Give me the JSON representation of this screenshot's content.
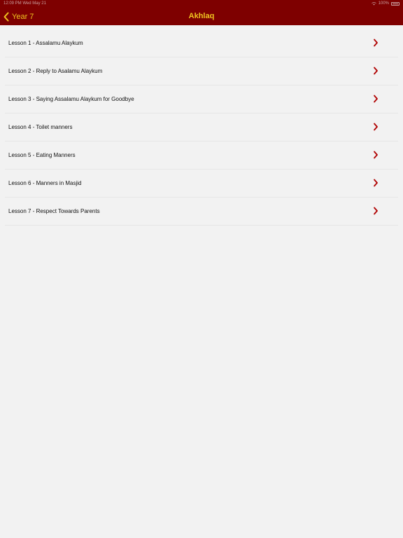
{
  "status_bar": {
    "time_date": "12:09 PM   Wed May 21",
    "battery": "100%",
    "icons": [
      "wifi-icon",
      "battery-icon"
    ]
  },
  "nav": {
    "back_label": "Year 7",
    "title": "Akhlaq",
    "back_icon": "chevron-left-icon"
  },
  "lessons": [
    {
      "label": "Lesson 1 - Assalamu Alaykum"
    },
    {
      "label": "Lesson 2 - Reply to Asalamu Alaykum"
    },
    {
      "label": "Lesson 3 - Saying Assalamu Alaykum for Goodbye"
    },
    {
      "label": "Lesson 4 - Toilet manners"
    },
    {
      "label": "Lesson 5 - Eating Manners"
    },
    {
      "label": "Lesson 6 - Manners in Masjid"
    },
    {
      "label": "Lesson 7 - Respect Towards Parents"
    }
  ],
  "colors": {
    "nav_background": "#7e0000",
    "nav_text": "#f0c420",
    "chevron": "#b00000",
    "page_background": "#f2f2f2"
  }
}
